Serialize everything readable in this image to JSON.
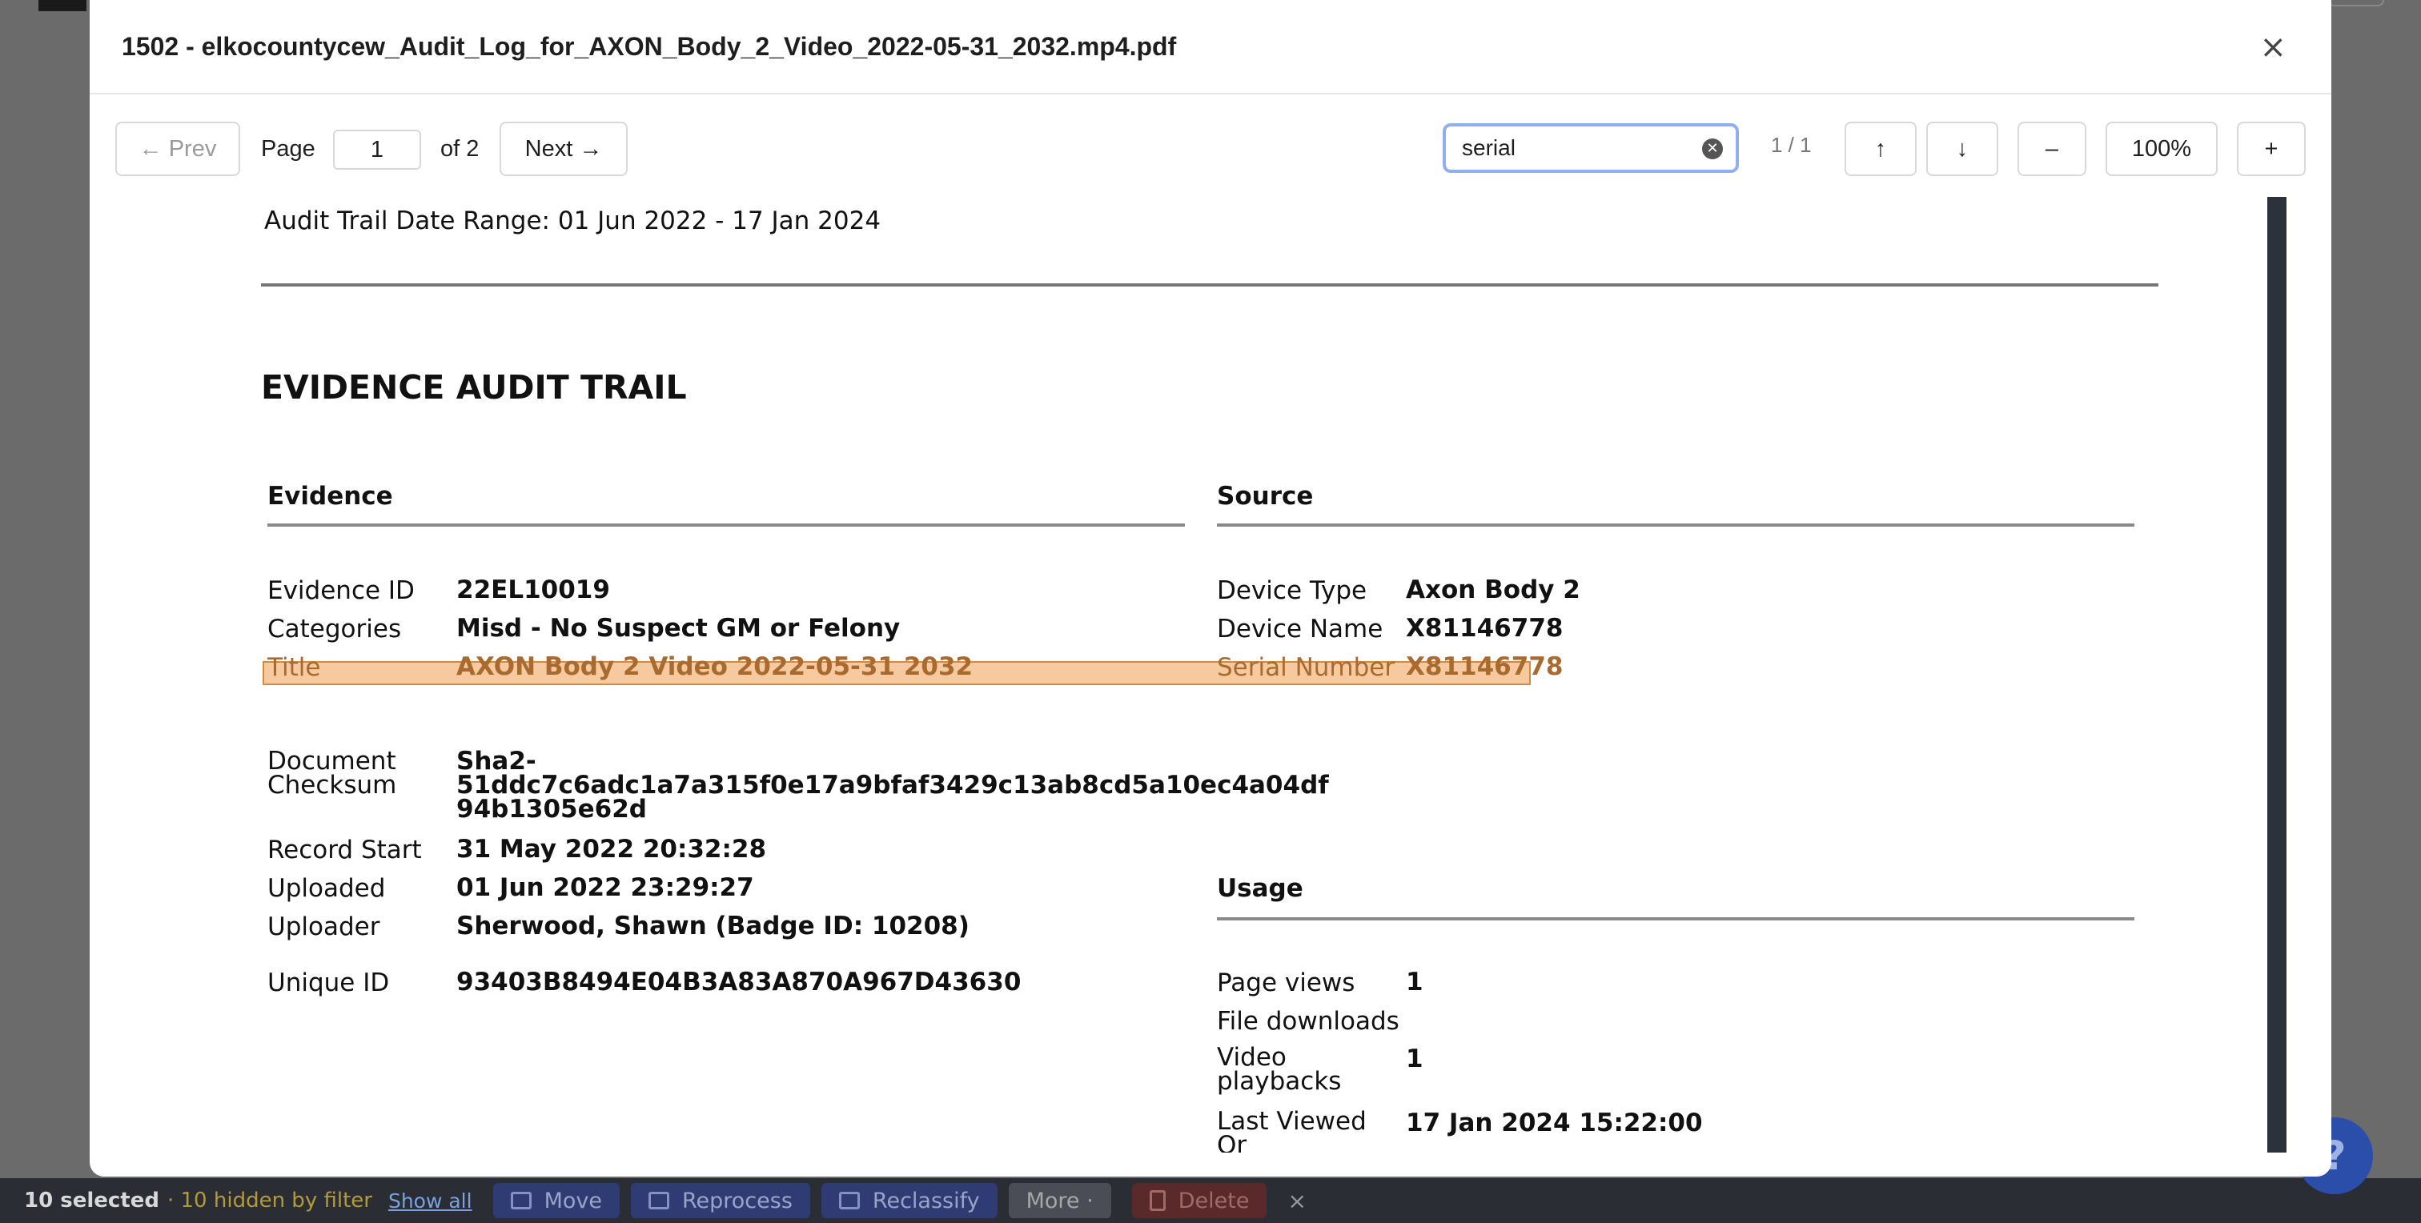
{
  "modal": {
    "title": "1502 - elkocountycew_Audit_Log_for_AXON_Body_2_Video_2022-05-31_2032.mp4.pdf",
    "close": "×"
  },
  "toolbar": {
    "prev": "← Prev",
    "page_label": "Page",
    "page_value": "1",
    "of_total": "of 2",
    "next": "Next →",
    "search_value": "serial",
    "match_count": "1 / 1",
    "up": "↑",
    "down": "↓",
    "zoom_out": "–",
    "zoom": "100%",
    "zoom_in": "+"
  },
  "document": {
    "date_range": "Audit Trail Date Range: 01 Jun 2022 - 17 Jan 2024",
    "heading": "EVIDENCE AUDIT TRAIL",
    "evidence": {
      "heading": "Evidence",
      "evidence_id_label": "Evidence ID",
      "evidence_id": "22EL10019",
      "categories_label": "Categories",
      "categories": "Misd - No Suspect GM or Felony",
      "title_label": "Title",
      "title": "AXON Body 2 Video 2022-05-31 2032",
      "checksum_label_1": "Document",
      "checksum_label_2": "Checksum",
      "checksum_1": "Sha2-",
      "checksum_2": "51ddc7c6adc1a7a315f0e17a9bfaf3429c13ab8cd5a10ec4a04df",
      "checksum_3": "94b1305e62d",
      "record_start_label": "Record Start",
      "record_start": "31 May 2022 20:32:28",
      "uploaded_label": "Uploaded",
      "uploaded": "01 Jun 2022 23:29:27",
      "uploader_label": "Uploader",
      "uploader": "Sherwood, Shawn (Badge ID: 10208)",
      "unique_id_label": "Unique ID",
      "unique_id": "93403B8494E04B3A83A870A967D43630"
    },
    "source": {
      "heading": "Source",
      "device_type_label": "Device Type",
      "device_type": "Axon Body 2",
      "device_name_label": "Device Name",
      "device_name": "X81146778",
      "serial_label": "Serial Number",
      "serial": "X81146778"
    },
    "usage": {
      "heading": "Usage",
      "page_views_label": "Page views",
      "page_views": "1",
      "downloads_label": "File downloads",
      "playbacks_label_1": "Video",
      "playbacks_label_2": "playbacks",
      "playbacks": "1",
      "last_viewed_label_1": "Last Viewed",
      "last_viewed_label_2": "Or",
      "last_viewed": "17 Jan 2024 15:22:00"
    }
  },
  "bottom_bar": {
    "selected": "10 selected",
    "hidden": "· 10 hidden by filter",
    "show_all": "Show all",
    "move": "Move",
    "reprocess": "Reprocess",
    "reclassify": "Reclassify",
    "more": "More ·",
    "delete": "Delete",
    "close": "×"
  },
  "help": "?"
}
